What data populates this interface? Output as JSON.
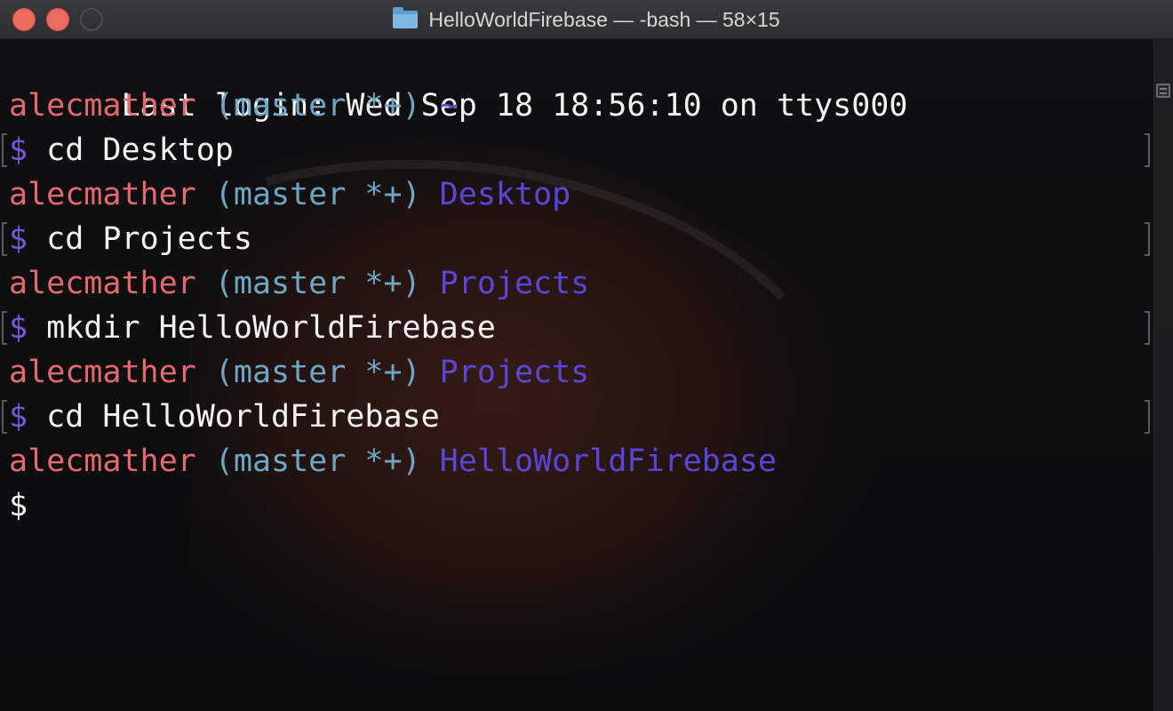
{
  "window": {
    "title": "HelloWorldFirebase — -bash — 58×15",
    "folder_icon": "folder-icon",
    "controls": [
      "close-button",
      "minimize-button",
      "zoom-button"
    ]
  },
  "colors": {
    "user": "#e4696e",
    "branch": "#6fa6c4",
    "directory": "#5a46d8",
    "prompt_symbol": "#7a57d9",
    "text": "#f2f2f2",
    "close": "#ec6a5e"
  },
  "terminal": {
    "login_line": "Last login: Wed Sep 18 18:56:10 on ttys000",
    "entries": [
      {
        "user": "alecmather",
        "branch": "(master *+)",
        "dir": "~",
        "prompt": "$",
        "command": "cd Desktop"
      },
      {
        "user": "alecmather",
        "branch": "(master *+)",
        "dir": "Desktop",
        "prompt": "$",
        "command": "cd Projects"
      },
      {
        "user": "alecmather",
        "branch": "(master *+)",
        "dir": "Projects",
        "prompt": "$",
        "command": "mkdir HelloWorldFirebase"
      },
      {
        "user": "alecmather",
        "branch": "(master *+)",
        "dir": "Projects",
        "prompt": "$",
        "command": "cd HelloWorldFirebase"
      },
      {
        "user": "alecmather",
        "branch": "(master *+)",
        "dir": "HelloWorldFirebase",
        "prompt": "$",
        "command": ""
      }
    ]
  },
  "scrollbar": {
    "icon": "scroll-lines-icon"
  }
}
